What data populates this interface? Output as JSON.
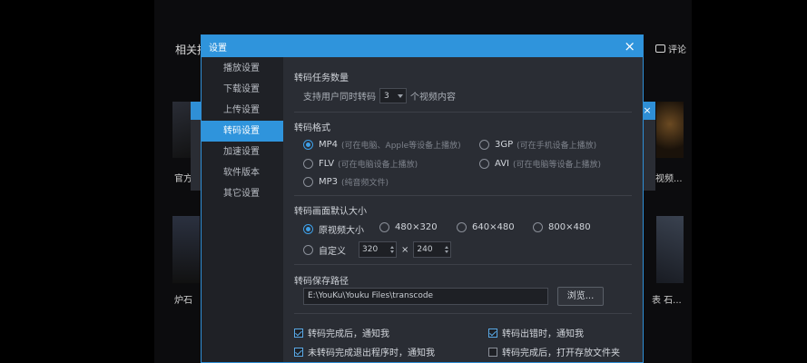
{
  "background": {
    "top_label": "相关推",
    "comment_label": "评论",
    "left_label_1": "官方",
    "left_label_2": "炉石",
    "right_label_1": "视频...",
    "right_label_2": "表 石...",
    "close_glyph": "×"
  },
  "dialog": {
    "title": "设置",
    "close_glyph": "×"
  },
  "sidebar": {
    "items": [
      {
        "label": "播放设置",
        "active": false
      },
      {
        "label": "下载设置",
        "active": false
      },
      {
        "label": "上传设置",
        "active": false
      },
      {
        "label": "转码设置",
        "active": true
      },
      {
        "label": "加速设置",
        "active": false
      },
      {
        "label": "软件版本",
        "active": false
      },
      {
        "label": "其它设置",
        "active": false
      }
    ]
  },
  "task_count": {
    "title": "转码任务数量",
    "prefix": "支持用户同时转码",
    "value": "3",
    "suffix": "个视频内容"
  },
  "format": {
    "title": "转码格式",
    "options": [
      {
        "label": "MP4",
        "note": "(可在电脑、Apple等设备上播放)",
        "checked": true
      },
      {
        "label": "3GP",
        "note": "(可在手机设备上播放)",
        "checked": false
      },
      {
        "label": "FLV",
        "note": "(可在电脑设备上播放)",
        "checked": false
      },
      {
        "label": "AVI",
        "note": "(可在电脑等设备上播放)",
        "checked": false
      },
      {
        "label": "MP3",
        "note": "(纯音频文件)",
        "checked": false
      }
    ]
  },
  "resolution": {
    "title": "转码画面默认大小",
    "options": [
      {
        "label": "原视频大小",
        "checked": true
      },
      {
        "label": "480×320",
        "checked": false
      },
      {
        "label": "640×480",
        "checked": false
      },
      {
        "label": "800×480",
        "checked": false
      }
    ],
    "custom_label": "自定义",
    "custom_width": "320",
    "times": "×",
    "custom_height": "240"
  },
  "save_path": {
    "title": "转码保存路径",
    "value": "E:\\YouKu\\Youku Files\\transcode",
    "browse_label": "浏览..."
  },
  "checkboxes": [
    {
      "label": "转码完成后，通知我",
      "checked": true
    },
    {
      "label": "转码出错时，通知我",
      "checked": true
    },
    {
      "label": "未转码完成退出程序时，通知我",
      "checked": true
    },
    {
      "label": "转码完成后，打开存放文件夹",
      "checked": false
    }
  ],
  "colors": {
    "accent": "#2f94dc",
    "dialog_bg": "#2a2d34",
    "sidebar_bg": "#1f2126"
  }
}
